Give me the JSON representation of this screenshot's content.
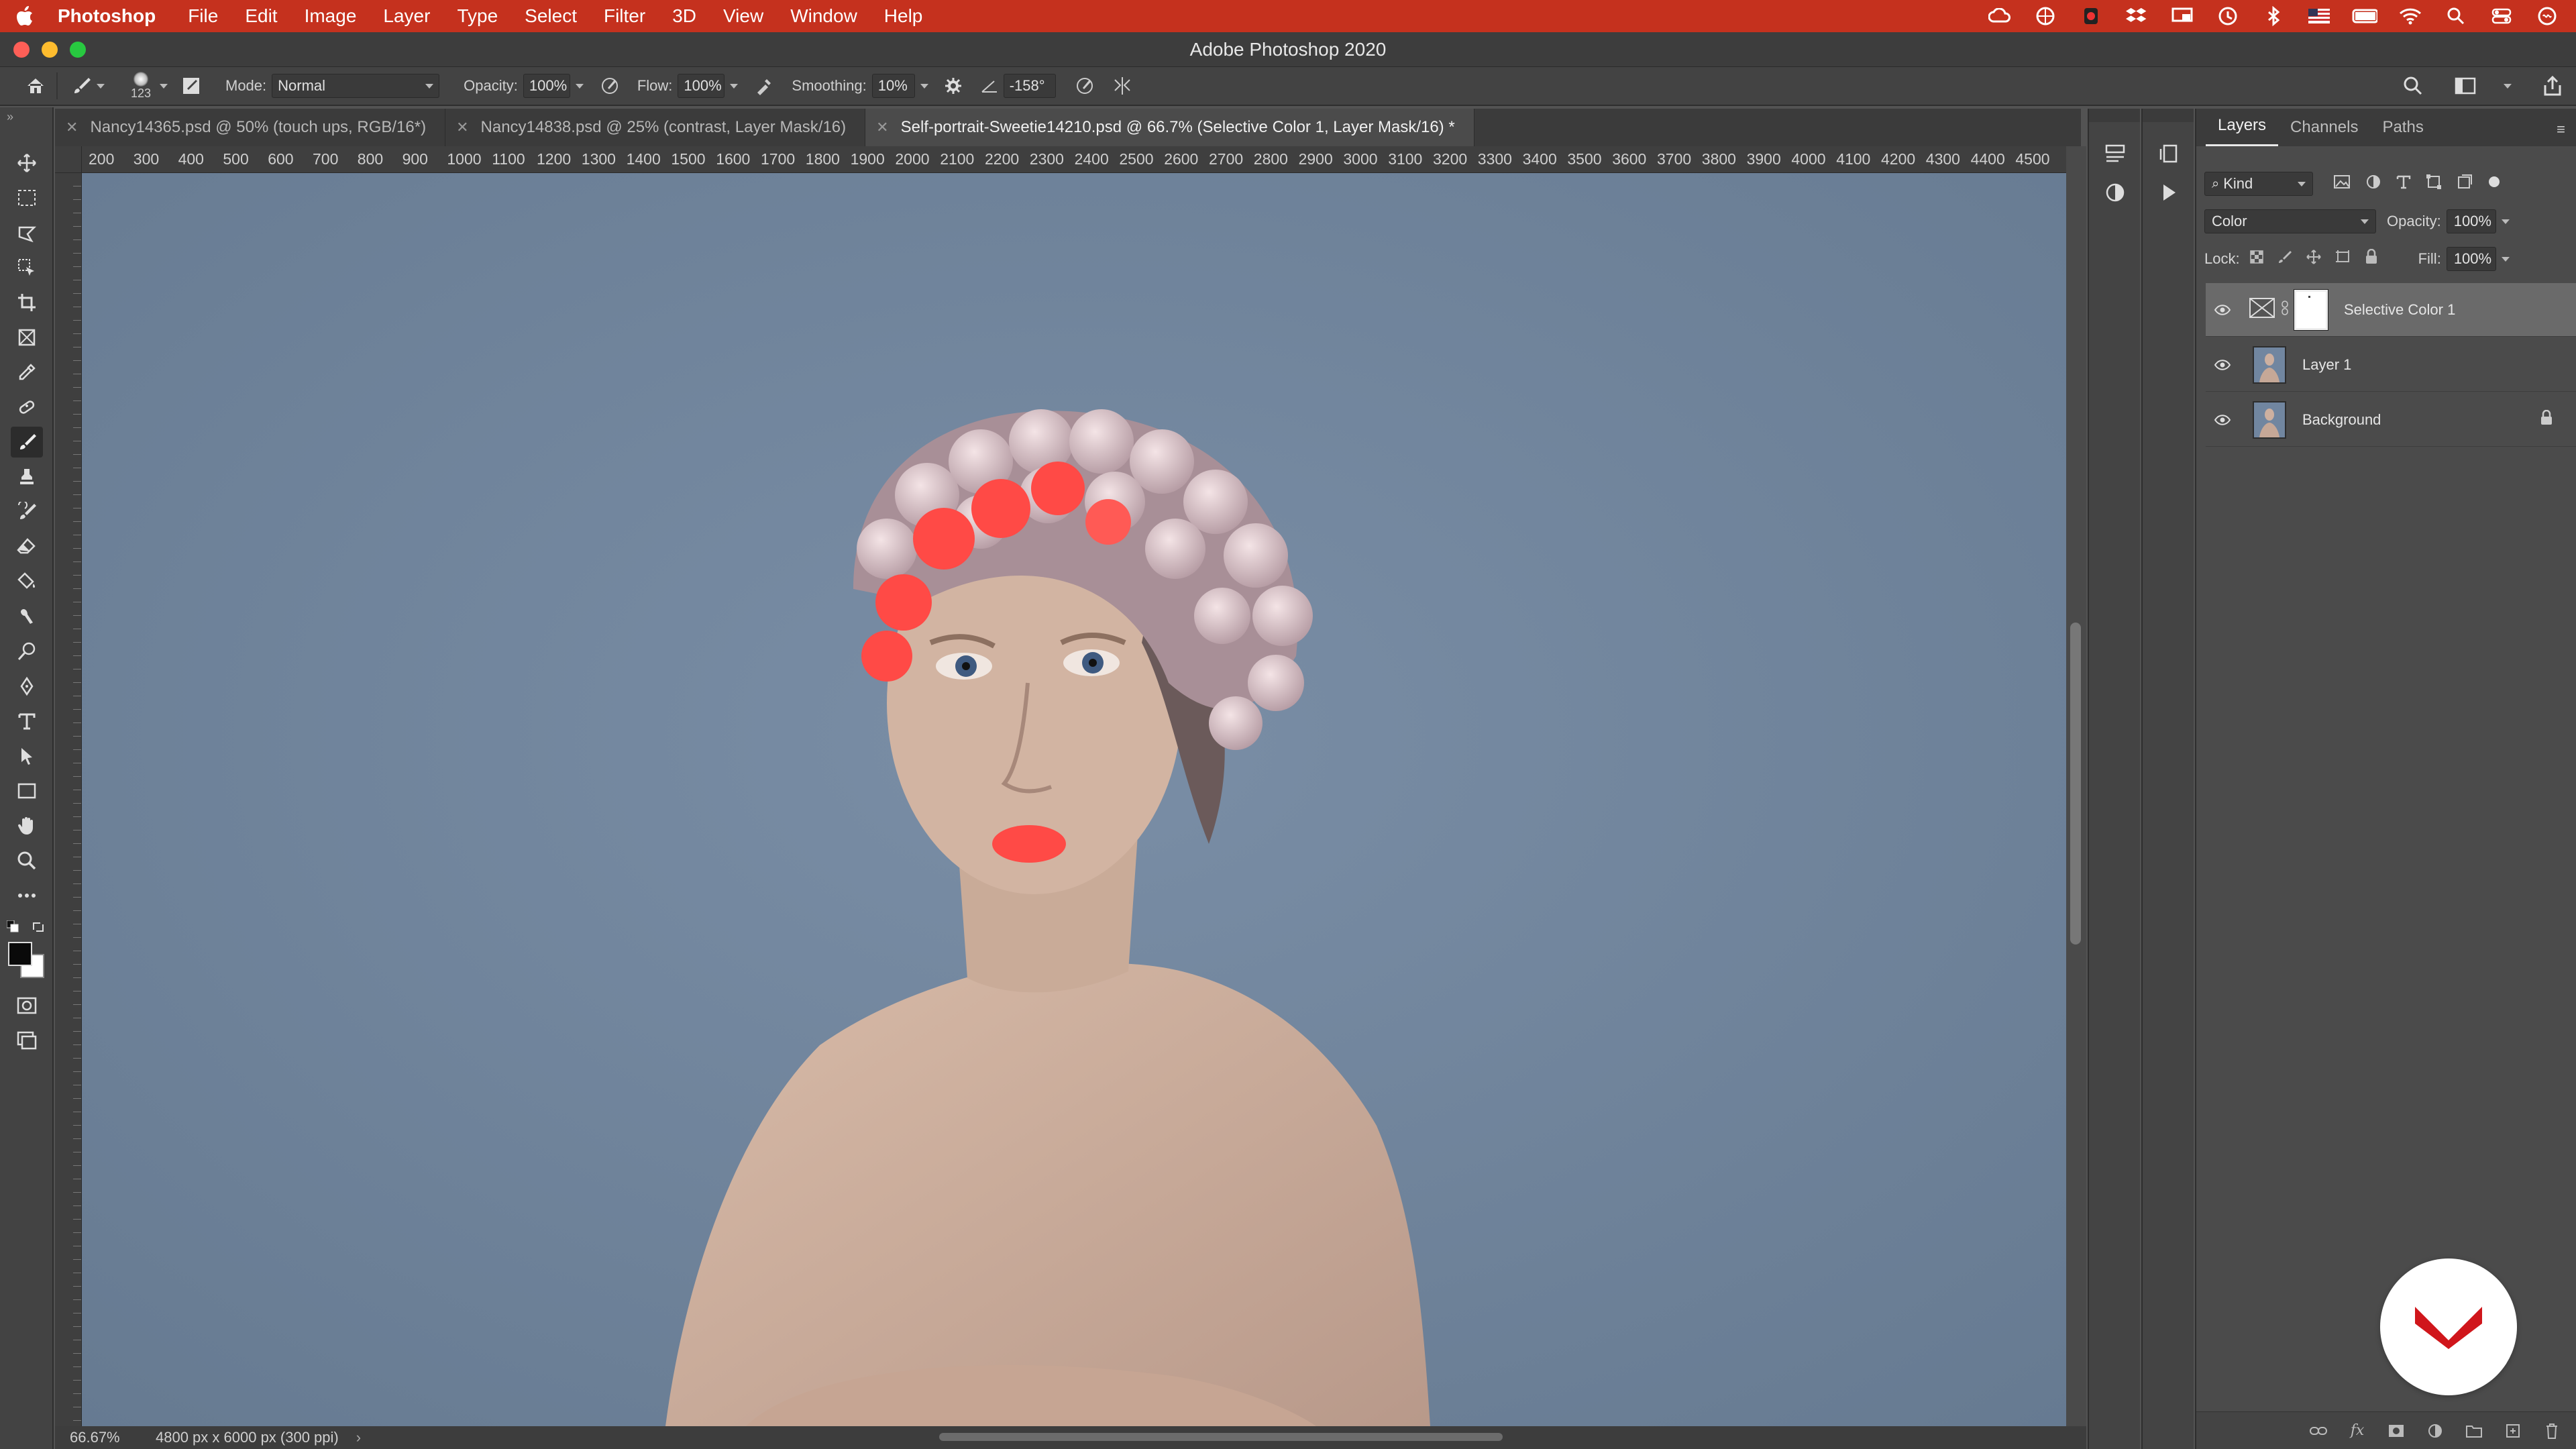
{
  "menubar": {
    "app_name": "Photoshop",
    "items": [
      "File",
      "Edit",
      "Image",
      "Layer",
      "Type",
      "Select",
      "Filter",
      "3D",
      "View",
      "Window",
      "Help"
    ],
    "status_icons": [
      "creative-cloud-icon",
      "color-wheel-icon",
      "notification-icon",
      "dropbox-icon",
      "screen-mirroring-icon",
      "time-machine-icon",
      "bluetooth-icon",
      "flag-icon",
      "battery-icon",
      "wifi-icon",
      "spotlight-search-icon",
      "control-center-icon",
      "siri-icon"
    ],
    "bar_color": "#c5311e"
  },
  "window": {
    "title": "Adobe Photoshop 2020"
  },
  "options_bar": {
    "brush_size": "123",
    "mode_label": "Mode:",
    "mode_value": "Normal",
    "opacity_label": "Opacity:",
    "opacity_value": "100%",
    "flow_label": "Flow:",
    "flow_value": "100%",
    "smoothing_label": "Smoothing:",
    "smoothing_value": "10%",
    "angle_value": "-158°"
  },
  "tabs": [
    {
      "label": "Nancy14365.psd @ 50% (touch ups, RGB/16*)",
      "active": false
    },
    {
      "label": "Nancy14838.psd @ 25% (contrast, Layer Mask/16)",
      "active": false
    },
    {
      "label": "Self-portrait-Sweetie14210.psd @ 66.7% (Selective Color 1, Layer Mask/16) *",
      "active": true
    }
  ],
  "ruler_ticks": [
    "200",
    "300",
    "400",
    "500",
    "600",
    "700",
    "800",
    "900",
    "1000",
    "1100",
    "1200",
    "1300",
    "1400",
    "1500",
    "1600",
    "1700",
    "1800",
    "1900",
    "2000",
    "2100",
    "2200",
    "2300",
    "2400",
    "2500",
    "2600",
    "2700",
    "2800",
    "2900",
    "3000",
    "3100",
    "3200",
    "3300",
    "3400",
    "3500",
    "3600",
    "3700",
    "3800",
    "3900",
    "4000",
    "4100",
    "4200",
    "4300",
    "4400",
    "4500"
  ],
  "status": {
    "zoom": "66.67%",
    "doc_info": "4800 px x 6000 px (300 ppi)"
  },
  "layers_panel": {
    "tabs": [
      "Layers",
      "Channels",
      "Paths"
    ],
    "active_tab": "Layers",
    "filter_kind": "Kind",
    "blend_mode": "Color",
    "opacity_label": "Opacity:",
    "opacity_value": "100%",
    "lock_label": "Lock:",
    "fill_label": "Fill:",
    "fill_value": "100%",
    "layers": [
      {
        "name": "Selective Color 1",
        "selected": true,
        "locked": false
      },
      {
        "name": "Layer 1",
        "selected": false,
        "locked": false
      },
      {
        "name": "Background",
        "selected": false,
        "locked": true
      }
    ]
  },
  "colors": {
    "canvas_background": "#7185a0",
    "panel": "#4b4b4b",
    "accent_red": "#ff4a46"
  }
}
